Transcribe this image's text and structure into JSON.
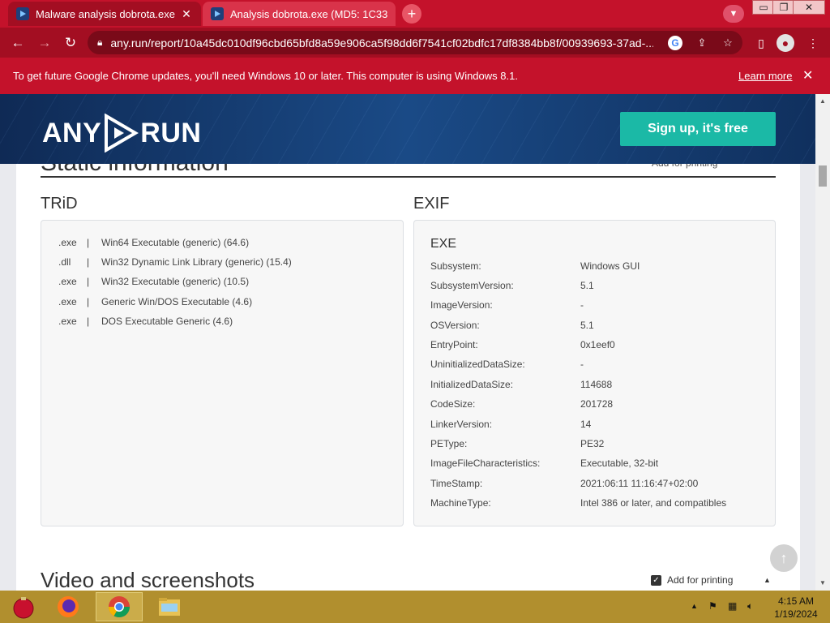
{
  "browser": {
    "tabs": [
      {
        "title": "Malware analysis dobrota.exe Malicious activity | ANY.RUN - Malware Sandbox Online",
        "active": true
      },
      {
        "title": "Analysis dobrota.exe (MD5: 1C33",
        "active": false
      }
    ],
    "new_tab_label": "+",
    "url": "any.run/report/10a45dc010df96cbd65bfd8a59e906ca5f98dd6f7541cf02bdfc17df8384bb8f/00939693-37ad-...",
    "window_controls": {
      "minimize": "▭",
      "maximize": "❐",
      "close": "✕"
    }
  },
  "infobar": {
    "message": "To get future Google Chrome updates, you'll need Windows 10 or later. This computer is using Windows 8.1.",
    "link": "Learn more",
    "close": "✕"
  },
  "site_header": {
    "logo_left": "ANY",
    "logo_right": "RUN",
    "signup_label": "Sign up, it's free"
  },
  "static_section": {
    "title": "Static information",
    "add_for_printing": "Add for printing"
  },
  "trid": {
    "title": "TRiD",
    "rows": [
      {
        "ext": ".exe",
        "desc": "Win64 Executable (generic) (64.6)"
      },
      {
        "ext": ".dll",
        "desc": "Win32 Dynamic Link Library (generic) (15.4)"
      },
      {
        "ext": ".exe",
        "desc": "Win32 Executable (generic) (10.5)"
      },
      {
        "ext": ".exe",
        "desc": "Generic Win/DOS Executable (4.6)"
      },
      {
        "ext": ".exe",
        "desc": "DOS Executable Generic (4.6)"
      }
    ]
  },
  "exif": {
    "title": "EXIF",
    "group": "EXE",
    "rows": [
      {
        "key": "Subsystem:",
        "value": "Windows GUI"
      },
      {
        "key": "SubsystemVersion:",
        "value": "5.1"
      },
      {
        "key": "ImageVersion:",
        "value": "-"
      },
      {
        "key": "OSVersion:",
        "value": "5.1"
      },
      {
        "key": "EntryPoint:",
        "value": "0x1eef0"
      },
      {
        "key": "UninitializedDataSize:",
        "value": "-"
      },
      {
        "key": "InitializedDataSize:",
        "value": "114688"
      },
      {
        "key": "CodeSize:",
        "value": "201728"
      },
      {
        "key": "LinkerVersion:",
        "value": "14"
      },
      {
        "key": "PEType:",
        "value": "PE32"
      },
      {
        "key": "ImageFileCharacteristics:",
        "value": "Executable, 32-bit"
      },
      {
        "key": "TimeStamp:",
        "value": "2021:06:11 11:16:47+02:00"
      },
      {
        "key": "MachineType:",
        "value": "Intel 386 or later, and compatibles"
      }
    ]
  },
  "video_section": {
    "title": "Video and screenshots",
    "add_for_printing": "Add for printing"
  },
  "taskbar": {
    "clock_time": "4:15 AM",
    "clock_date": "1/19/2024"
  },
  "colors": {
    "chrome_red": "#c4122b",
    "chrome_dark_red": "#a30e22",
    "signup_teal": "#1bb9a6",
    "taskbar_gold": "#b18f2e"
  }
}
